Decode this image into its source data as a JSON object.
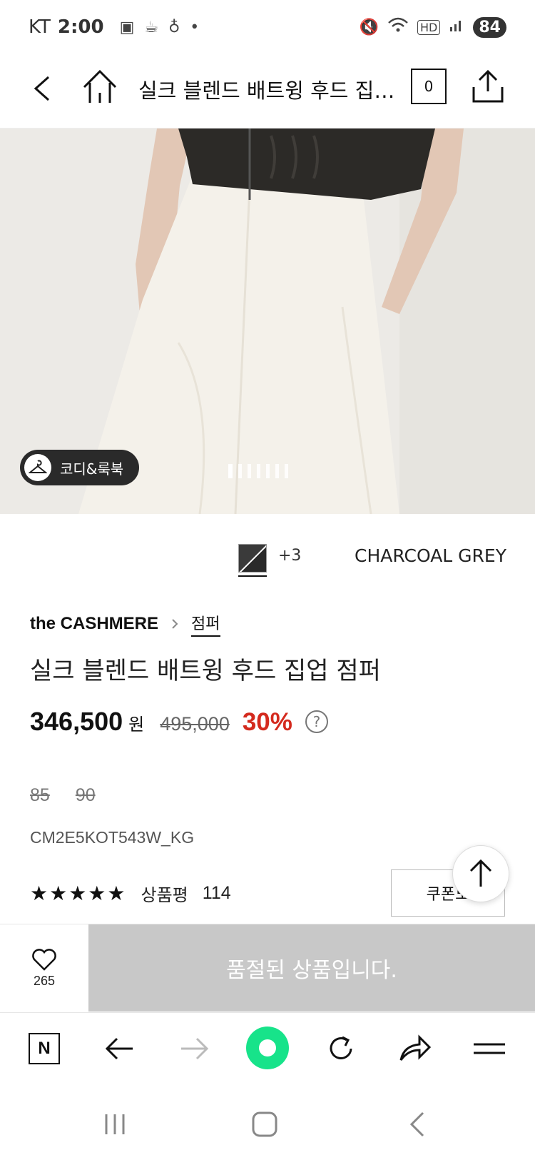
{
  "status_bar": {
    "carrier": "KT",
    "time": "2:00",
    "battery": "84"
  },
  "nav": {
    "title": "실크 블렌드 배트윙 후드 집업...",
    "cart_count": "0"
  },
  "image": {
    "codi_label": "코디&룩북",
    "slide_count": 7,
    "active_slide": 1
  },
  "color": {
    "more": "+3",
    "name": "CHARCOAL GREY"
  },
  "brand": {
    "name": "the CASHMERE",
    "category": "점퍼"
  },
  "product": {
    "title": "실크 블렌드 배트윙 후드 집업 점퍼",
    "price": "346,500",
    "price_unit": "원",
    "original_price": "495,000",
    "discount": "30%",
    "help": "?",
    "sizes": [
      "85",
      "90"
    ],
    "code": "CM2E5KOT543W_KG"
  },
  "reviews": {
    "stars": "★★★★★",
    "label": "상품평",
    "count": "114"
  },
  "coupon": {
    "label": "쿠폰노"
  },
  "purchase": {
    "wish_count": "265",
    "soldout_label": "품절된 상품입니다."
  },
  "colors": {
    "discount_red": "#d42a1e",
    "soldout_gray": "#c8c8c8",
    "green_button": "#17e38a"
  }
}
